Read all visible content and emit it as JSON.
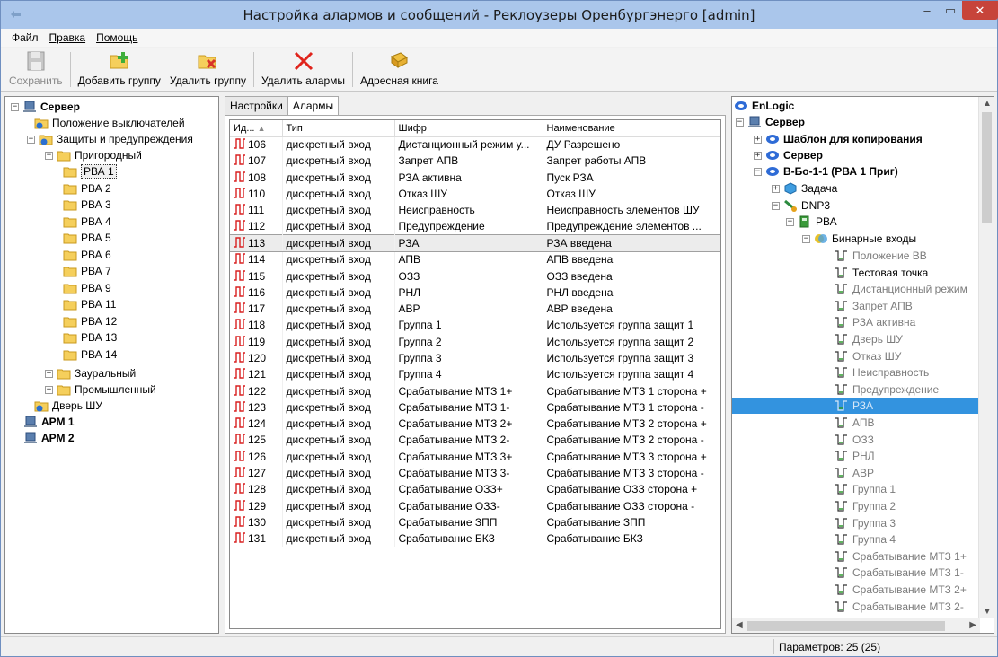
{
  "window": {
    "title": "Настройка алармов и сообщений - Реклоузеры Оренбургэнерго [admin]"
  },
  "menu": [
    "Файл",
    "Правка",
    "Помощь"
  ],
  "toolbar": {
    "save": "Сохранить",
    "add_group": "Добавить группу",
    "delete_group": "Удалить группу",
    "delete_alarms": "Удалить алармы",
    "address_book": "Адресная книга"
  },
  "left_tree": {
    "server": "Сервер",
    "switch_positions": "Положение выключателей",
    "protections": "Защиты и предупреждения",
    "prigorodny": "Пригородный",
    "rva": [
      "РВА 1",
      "РВА 2",
      "РВА 3",
      "РВА 4",
      "РВА 5",
      "РВА 6",
      "РВА 7",
      "РВА 9",
      "РВА 11",
      "РВА 12",
      "РВА 13",
      "РВА 14"
    ],
    "zauralny": "Зауральный",
    "promyshlenny": "Промышленный",
    "door": "Дверь ШУ",
    "arm1": "АРМ 1",
    "arm2": "АРМ 2"
  },
  "tabs": [
    "Настройки",
    "Алармы"
  ],
  "alarms_table": {
    "headers": [
      "Ид...",
      "Тип",
      "Шифр",
      "Наименование"
    ],
    "rows": [
      [
        "106",
        "дискретный вход",
        "Дистанционный режим у...",
        "ДУ Разрешено"
      ],
      [
        "107",
        "дискретный вход",
        "Запрет АПВ",
        "Запрет работы АПВ"
      ],
      [
        "108",
        "дискретный вход",
        "РЗА активна",
        "Пуск РЗА"
      ],
      [
        "110",
        "дискретный вход",
        "Отказ ШУ",
        "Отказ ШУ"
      ],
      [
        "111",
        "дискретный вход",
        "Неисправность",
        "Неисправность элементов ШУ"
      ],
      [
        "112",
        "дискретный вход",
        "Предупреждение",
        "Предупреждение элементов ..."
      ],
      [
        "113",
        "дискретный вход",
        "РЗА",
        "РЗА введена"
      ],
      [
        "114",
        "дискретный вход",
        "АПВ",
        "АПВ введена"
      ],
      [
        "115",
        "дискретный вход",
        "ОЗЗ",
        "ОЗЗ введена"
      ],
      [
        "116",
        "дискретный вход",
        "РНЛ",
        "РНЛ введена"
      ],
      [
        "117",
        "дискретный вход",
        "АВР",
        "АВР введена"
      ],
      [
        "118",
        "дискретный вход",
        "Группа 1",
        "Используется группа защит 1"
      ],
      [
        "119",
        "дискретный вход",
        "Группа 2",
        "Используется группа защит 2"
      ],
      [
        "120",
        "дискретный вход",
        "Группа 3",
        "Используется группа защит 3"
      ],
      [
        "121",
        "дискретный вход",
        "Группа 4",
        "Используется группа защит 4"
      ],
      [
        "122",
        "дискретный вход",
        "Срабатывание МТЗ 1+",
        "Срабатывание МТЗ 1 сторона +"
      ],
      [
        "123",
        "дискретный вход",
        "Срабатывание МТЗ 1-",
        "Срабатывание МТЗ 1 сторона -"
      ],
      [
        "124",
        "дискретный вход",
        "Срабатывание МТЗ 2+",
        "Срабатывание МТЗ 2 сторона +"
      ],
      [
        "125",
        "дискретный вход",
        "Срабатывание МТЗ 2-",
        "Срабатывание МТЗ 2 сторона -"
      ],
      [
        "126",
        "дискретный вход",
        "Срабатывание МТЗ 3+",
        "Срабатывание МТЗ 3 сторона +"
      ],
      [
        "127",
        "дискретный вход",
        "Срабатывание МТЗ 3-",
        "Срабатывание МТЗ 3 сторона -"
      ],
      [
        "128",
        "дискретный вход",
        "Срабатывание ОЗЗ+",
        "Срабатывание ОЗЗ сторона +"
      ],
      [
        "129",
        "дискретный вход",
        "Срабатывание ОЗЗ-",
        "Срабатывание ОЗЗ сторона -"
      ],
      [
        "130",
        "дискретный вход",
        "Срабатывание ЗПП",
        "Срабатывание ЗПП"
      ],
      [
        "131",
        "дискретный вход",
        "Срабатывание БКЗ",
        "Срабатывание БКЗ"
      ]
    ]
  },
  "right_tree": {
    "root": "EnLogic",
    "server": "Сервер",
    "template": "Шаблон для копирования",
    "server2": "Сервер",
    "device": "В-Бо-1-1 (РВА 1 Приг)",
    "task": "Задача",
    "dnp3": "DNP3",
    "rva": "РВА",
    "binary_inputs": "Бинарные входы",
    "points": [
      "Положение ВВ",
      "Тестовая точка",
      "Дистанционный режим",
      "Запрет АПВ",
      "РЗА активна",
      "Дверь ШУ",
      "Отказ ШУ",
      "Неисправность",
      "Предупреждение",
      "РЗА",
      "АПВ",
      "ОЗЗ",
      "РНЛ",
      "АВР",
      "Группа 1",
      "Группа 2",
      "Группа 3",
      "Группа 4",
      "Срабатывание МТЗ 1+",
      "Срабатывание МТЗ 1-",
      "Срабатывание МТЗ 2+",
      "Срабатывание МТЗ 2-"
    ]
  },
  "status": {
    "params": "Параметров: 25 (25)"
  }
}
